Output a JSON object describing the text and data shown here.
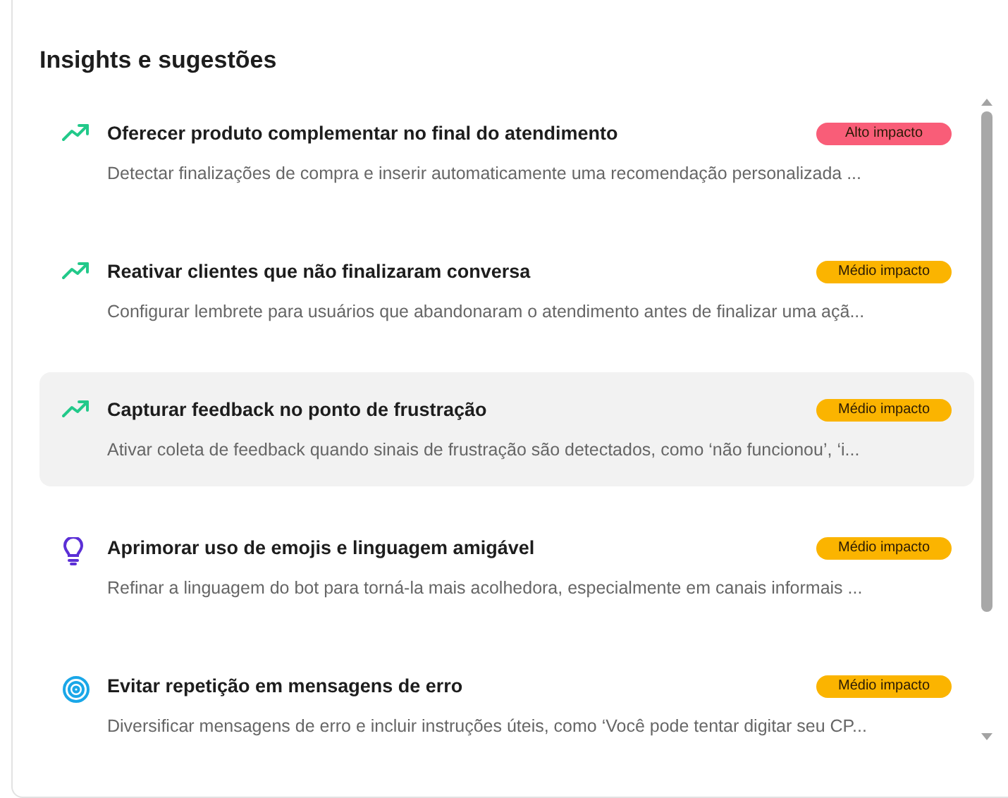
{
  "title": "Insights e sugestões",
  "insights": [
    {
      "kind": "trend",
      "title": "Oferecer produto complementar no final do atendimento",
      "description": "Detectar finalizações de compra e inserir automaticamente uma recomendação personalizada ...",
      "badge": "Alto impacto",
      "color": "#f95d78",
      "selected": false
    },
    {
      "kind": "trend",
      "title": "Reativar clientes que não finalizaram conversa",
      "description": "Configurar lembrete para usuários que abandonaram o atendimento antes de finalizar uma açã...",
      "badge": "Médio impacto",
      "color": "#fbb400",
      "selected": false
    },
    {
      "kind": "trend",
      "title": "Capturar feedback no ponto de frustração",
      "description": "Ativar coleta de feedback quando sinais de frustração são detectados, como ‘não funcionou’, ‘i...",
      "badge": "Médio impacto",
      "color": "#fbb400",
      "selected": true
    },
    {
      "kind": "bulb",
      "title": "Aprimorar uso de emojis e linguagem amigável",
      "description": "Refinar a linguagem do bot para torná-la mais acolhedora, especialmente em canais informais ...",
      "badge": "Médio impacto",
      "color": "#fbb400",
      "selected": false
    },
    {
      "kind": "target",
      "title": "Evitar repetição em mensagens de erro",
      "description": "Diversificar mensagens de erro e incluir instruções úteis, como ‘Você pode tentar digitar seu CP...",
      "badge": "Médio impacto",
      "color": "#fbb400",
      "selected": false
    }
  ]
}
